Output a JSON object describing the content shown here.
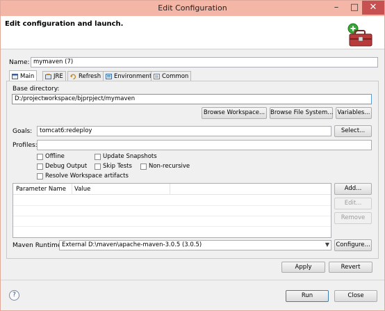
{
  "window": {
    "title": "Edit Configuration",
    "minimize": "–",
    "maximize": "□",
    "close": "✕"
  },
  "header": {
    "text": "Edit configuration and launch.",
    "icon": "toolbox-icon"
  },
  "name": {
    "label": "Name:",
    "value": "mymaven (7)"
  },
  "tabs": [
    {
      "label": "Main",
      "icon": "main-tab-icon"
    },
    {
      "label": "JRE",
      "icon": "jre-icon"
    },
    {
      "label": "Refresh",
      "icon": "refresh-icon"
    },
    {
      "label": "Environment",
      "icon": "environment-icon"
    },
    {
      "label": "Common",
      "icon": "common-icon"
    }
  ],
  "main": {
    "base_dir_label": "Base directory:",
    "base_dir_value": "D:/projectworkspace/bjprpject/mymaven",
    "browse_workspace": "Browse Workspace...",
    "browse_fs": "Browse File System...",
    "variables": "Variables...",
    "goals_label": "Goals:",
    "goals_value": "tomcat6:redeploy",
    "select": "Select...",
    "profiles_label": "Profiles:",
    "profiles_value": "",
    "checkboxes": {
      "offline": "Offline",
      "update_snapshots": "Update Snapshots",
      "debug_output": "Debug Output",
      "skip_tests": "Skip Tests",
      "non_recursive": "Non-recursive",
      "resolve_workspace": "Resolve Workspace artifacts"
    },
    "param_table": {
      "col_name": "Parameter Name",
      "col_value": "Value"
    },
    "add": "Add...",
    "edit": "Edit...",
    "remove": "Remove",
    "runtime_label": "Maven Runtime:",
    "runtime_value": "External D:\\maven\\apache-maven-3.0.5 (3.0.5)",
    "configure": "Configure..."
  },
  "footer": {
    "apply": "Apply",
    "revert": "Revert",
    "run": "Run",
    "close": "Close",
    "help": "?"
  }
}
